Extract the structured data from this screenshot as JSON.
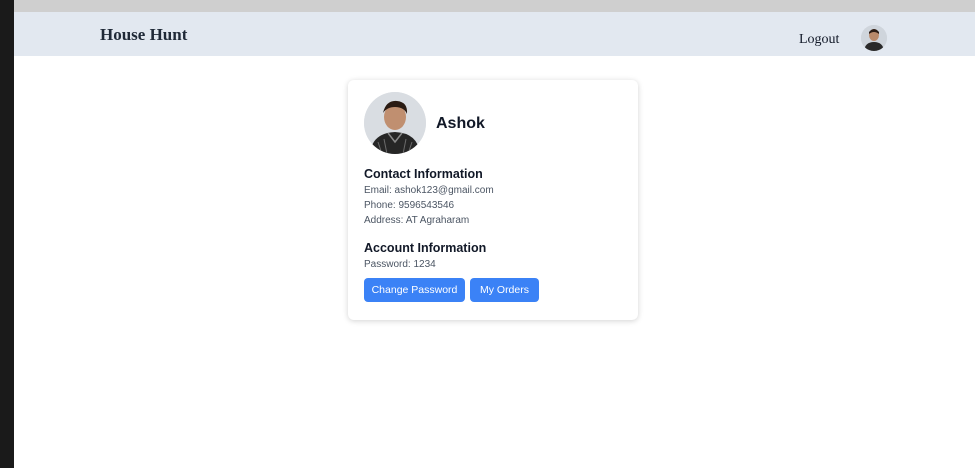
{
  "navbar": {
    "brand": "House Hunt",
    "logout_label": "Logout",
    "avatar_icon": "user-avatar-icon"
  },
  "profile": {
    "name": "Ashok",
    "avatar_icon": "profile-photo-icon"
  },
  "contact": {
    "title": "Contact Information",
    "email": "Email: ashok123@gmail.com",
    "phone": "Phone: 9596543546",
    "address": "Address: AT Agraharam"
  },
  "account": {
    "title": "Account Information",
    "password": "Password: 1234"
  },
  "buttons": {
    "change_password": "Change Password",
    "my_orders": "My Orders"
  },
  "colors": {
    "navbar_bg": "#e2e8f0",
    "button_bg": "#3b82f6"
  }
}
